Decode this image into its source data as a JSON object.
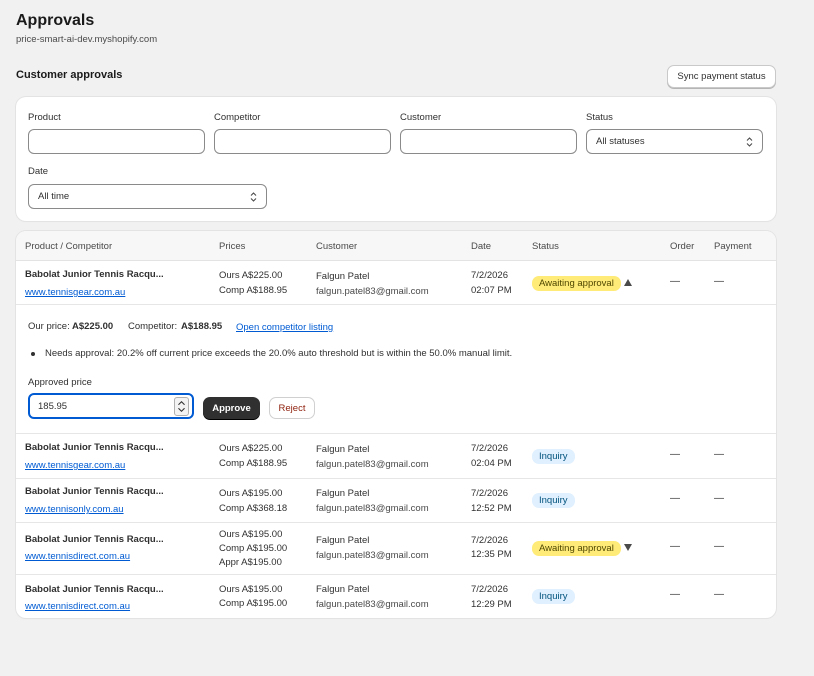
{
  "header": {
    "title": "Approvals",
    "subtitle": "price-smart-ai-dev.myshopify.com",
    "section_title": "Customer approvals",
    "sync_button": "Sync payment status"
  },
  "filters": {
    "product_label": "Product",
    "competitor_label": "Competitor",
    "customer_label": "Customer",
    "status_label": "Status",
    "status_value": "All statuses",
    "date_label": "Date",
    "date_value": "All time"
  },
  "table": {
    "columns": [
      "Product / Competitor",
      "Prices",
      "Customer",
      "Date",
      "Status",
      "Order",
      "Payment"
    ],
    "rows": [
      {
        "product": "Babolat Junior Tennis Racqu...",
        "competitor_url": "www.tennisgear.com.au",
        "prices": [
          "Ours A$225.00",
          "Comp A$188.95"
        ],
        "customer_name": "Falgun Patel",
        "customer_email": "falgun.patel83@gmail.com",
        "date": "7/2/2026",
        "time": "02:07 PM",
        "status": "Awaiting approval",
        "order": "—",
        "payment": "—"
      },
      {
        "product": "Babolat Junior Tennis Racqu...",
        "competitor_url": "www.tennisgear.com.au",
        "prices": [
          "Ours A$225.00",
          "Comp A$188.95"
        ],
        "customer_name": "Falgun Patel",
        "customer_email": "falgun.patel83@gmail.com",
        "date": "7/2/2026",
        "time": "02:04 PM",
        "status": "Inquiry",
        "order": "—",
        "payment": "—"
      },
      {
        "product": "Babolat Junior Tennis Racqu...",
        "competitor_url": "www.tennisonly.com.au",
        "prices": [
          "Ours A$195.00",
          "Comp A$368.18"
        ],
        "customer_name": "Falgun Patel",
        "customer_email": "falgun.patel83@gmail.com",
        "date": "7/2/2026",
        "time": "12:52 PM",
        "status": "Inquiry",
        "order": "—",
        "payment": "—"
      },
      {
        "product": "Babolat Junior Tennis Racqu...",
        "competitor_url": "www.tennisdirect.com.au",
        "prices": [
          "Ours A$195.00",
          "Comp A$195.00",
          "Appr A$195.00"
        ],
        "customer_name": "Falgun Patel",
        "customer_email": "falgun.patel83@gmail.com",
        "date": "7/2/2026",
        "time": "12:35 PM",
        "status": "Awaiting approval",
        "order": "—",
        "payment": "—"
      },
      {
        "product": "Babolat Junior Tennis Racqu...",
        "competitor_url": "www.tennisdirect.com.au",
        "prices": [
          "Ours A$195.00",
          "Comp A$195.00"
        ],
        "customer_name": "Falgun Patel",
        "customer_email": "falgun.patel83@gmail.com",
        "date": "7/2/2026",
        "time": "12:29 PM",
        "status": "Inquiry",
        "order": "—",
        "payment": "—"
      }
    ]
  },
  "detail": {
    "our_price_label": "Our price:",
    "our_price_value": "A$225.00",
    "competitor_label": "Competitor:",
    "competitor_value": "A$188.95",
    "open_link": "Open competitor listing",
    "note": "Needs approval: 20.2% off current price exceeds the 20.0% auto threshold but is within the 50.0% manual limit.",
    "approved_price_label": "Approved price",
    "approved_price_value": "185.95",
    "approve_button": "Approve",
    "reject_button": "Reject"
  },
  "colors": {
    "awaiting_badge": "#ffeb78",
    "inquiry_badge": "#e0f0ff",
    "link": "#005bd3"
  },
  "icons": {
    "expanded_row": "caret-up-icon",
    "collapsed_row": "caret-down-icon",
    "select": "select-arrows-icon",
    "stepper": "number-stepper-icon"
  }
}
